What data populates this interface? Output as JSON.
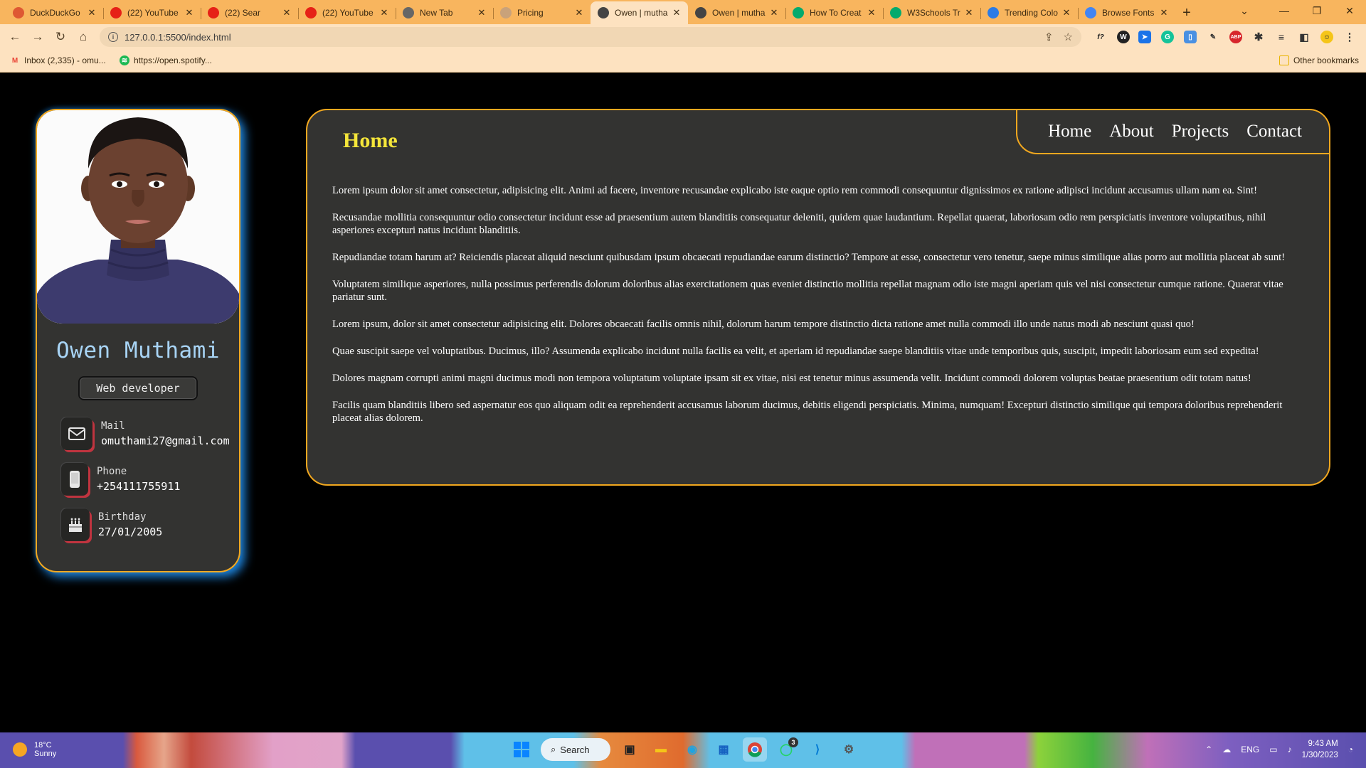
{
  "browser": {
    "tabs": [
      {
        "title": "DuckDuckGo",
        "icon": "duckduckgo-icon",
        "color": "#de5833",
        "active": false
      },
      {
        "title": "(22) YouTube",
        "icon": "youtube-icon",
        "color": "#e62117",
        "active": false
      },
      {
        "title": "(22) Sear",
        "icon": "youtube-icon",
        "color": "#e62117",
        "active": false
      },
      {
        "title": "(22) YouTube",
        "icon": "youtube-icon",
        "color": "#e62117",
        "active": false
      },
      {
        "title": "New Tab",
        "icon": "chrome-icon",
        "color": "#666666",
        "active": false
      },
      {
        "title": "Pricing",
        "icon": "dots-icon",
        "color": "#c9a27a",
        "active": false
      },
      {
        "title": "Owen | mutha",
        "icon": "globe-icon",
        "color": "#444444",
        "active": true
      },
      {
        "title": "Owen | mutha",
        "icon": "globe-icon",
        "color": "#444444",
        "active": false
      },
      {
        "title": "How To Creat",
        "icon": "w3schools-icon",
        "color": "#04aa6d",
        "active": false
      },
      {
        "title": "W3Schools Tr",
        "icon": "w3schools-icon",
        "color": "#04aa6d",
        "active": false
      },
      {
        "title": "Trending Colo",
        "icon": "coolors-icon",
        "color": "#2c7be5",
        "active": false
      },
      {
        "title": "Browse Fonts",
        "icon": "google-fonts-icon",
        "color": "#4285f4",
        "active": false
      }
    ],
    "new_tab": "+",
    "url": "127.0.0.1:5500/index.html",
    "bookmarks": [
      {
        "label": "Inbox (2,335) - omu...",
        "icon": "gmail-icon",
        "color": "#ea4335"
      },
      {
        "label": "https://open.spotify...",
        "icon": "spotify-icon",
        "color": "#1db954"
      }
    ],
    "other_bookmarks": "Other bookmarks"
  },
  "profile": {
    "name": "Owen Muthami",
    "role": "Web developer",
    "contacts": [
      {
        "label": "Mail",
        "value": "omuthami27@gmail.com",
        "icon": "envelope-icon"
      },
      {
        "label": "Phone",
        "value": "+254111755911",
        "icon": "phone-icon"
      },
      {
        "label": "Birthday",
        "value": "27/01/2005",
        "icon": "cake-icon"
      }
    ]
  },
  "main": {
    "title": "Home",
    "nav": [
      "Home",
      "About",
      "Projects",
      "Contact"
    ],
    "paragraphs": [
      "Lorem ipsum dolor sit amet consectetur, adipisicing elit. Animi ad facere, inventore recusandae explicabo iste eaque optio rem commodi consequuntur dignissimos ex ratione adipisci incidunt accusamus ullam nam ea. Sint!",
      "Recusandae mollitia consequuntur odio consectetur incidunt esse ad praesentium autem blanditiis consequatur deleniti, quidem quae laudantium. Repellat quaerat, laboriosam odio rem perspiciatis inventore voluptatibus, nihil asperiores excepturi natus incidunt blanditiis.",
      "Repudiandae totam harum at? Reiciendis placeat aliquid nesciunt quibusdam ipsum obcaecati repudiandae earum distinctio? Tempore at esse, consectetur vero tenetur, saepe minus similique alias porro aut mollitia placeat ab sunt!",
      "Voluptatem similique asperiores, nulla possimus perferendis dolorum doloribus alias exercitationem quas eveniet distinctio mollitia repellat magnam odio iste magni aperiam quis vel nisi consectetur cumque ratione. Quaerat vitae pariatur sunt.",
      "Lorem ipsum, dolor sit amet consectetur adipisicing elit. Dolores obcaecati facilis omnis nihil, dolorum harum tempore distinctio dicta ratione amet nulla commodi illo unde natus modi ab nesciunt quasi quo!",
      "Quae suscipit saepe vel voluptatibus. Ducimus, illo? Assumenda explicabo incidunt nulla facilis ea velit, et aperiam id repudiandae saepe blanditiis vitae unde temporibus quis, suscipit, impedit laboriosam eum sed expedita!",
      "Dolores magnam corrupti animi magni ducimus modi non tempora voluptatum voluptate ipsam sit ex vitae, nisi est tenetur minus assumenda velit. Incidunt commodi dolorem voluptas beatae praesentium odit totam natus!",
      "Facilis quam blanditiis libero sed aspernatur eos quo aliquam odit ea reprehenderit accusamus laborum ducimus, debitis eligendi perspiciatis. Minima, numquam! Excepturi distinctio similique qui tempora doloribus reprehenderit placeat alias dolorem."
    ]
  },
  "taskbar": {
    "weather_temp": "18°C",
    "weather_desc": "Sunny",
    "search_label": "Search",
    "whatsapp_badge": "3",
    "language": "ENG",
    "time": "9:43 AM",
    "date": "1/30/2023"
  },
  "colors": {
    "accent_orange": "#f2a81f",
    "title_yellow": "#f5e63a",
    "name_blue": "#a8d4f5",
    "glow_blue": "#1f8ae6",
    "card_bg": "#333331"
  }
}
